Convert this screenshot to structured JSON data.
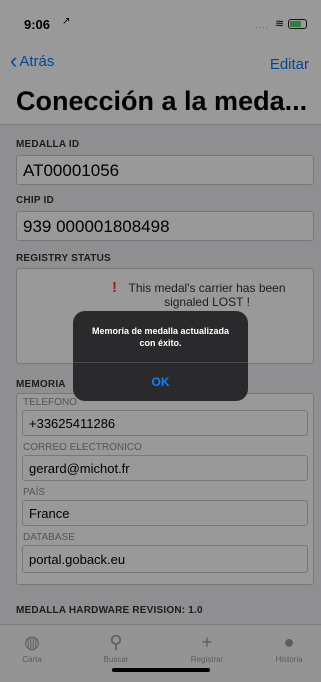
{
  "status_bar": {
    "time": "9:06",
    "location_glyph": "↗",
    "signal": "....",
    "wifi_glyph": "≋"
  },
  "nav": {
    "back_label": "Atrás",
    "edit_label": "Editar"
  },
  "title": "Conección a la meda...",
  "fields": {
    "medal_id_label": "MEDALLA ID",
    "medal_id_value": "AT00001056",
    "chip_id_label": "CHIP ID",
    "chip_id_value": "939 000001808498",
    "registry_status_label": "REGISTRY STATUS",
    "registry_status_mark": "!",
    "registry_status_text": "This medal's carrier has been signaled LOST !",
    "memory_label": "MEMORIA",
    "telefono_label": "TELEFONO",
    "telefono_value": "+33625411286",
    "correo_label": "CORREO ELECTRONICO",
    "correo_value": "gerard@michot.fr",
    "pais_label": "PAÍS",
    "pais_value": "France",
    "database_label": "DATABASE",
    "database_value": "portal.goback.eu",
    "hardware_label": "MEDALLA HARDWARE REVISION: 1.0"
  },
  "alert": {
    "message": "Memoria de medalla actualizada con éxito.",
    "ok_label": "OK"
  },
  "tabs": [
    {
      "label": "Carta",
      "icon": "globe-icon",
      "glyph": "◍"
    },
    {
      "label": "Buscar",
      "icon": "search-icon",
      "glyph": "⚲"
    },
    {
      "label": "Registrar",
      "icon": "plus-icon",
      "glyph": "+"
    },
    {
      "label": "Historia",
      "icon": "history-icon",
      "glyph": "●"
    }
  ],
  "colors": {
    "accent": "#007aff",
    "alert_bg": "#2a2a2c",
    "alert_button": "#0a84ff",
    "lost_red": "#ff3b30",
    "form_bg": "#efeff4"
  }
}
